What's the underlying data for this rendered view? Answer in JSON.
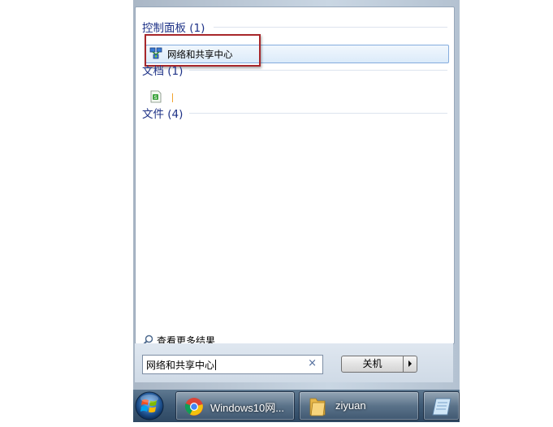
{
  "menu": {
    "sections": [
      {
        "header": "控制面板 (1)"
      },
      {
        "header": "文档 (1)"
      },
      {
        "header": "文件 (4)"
      }
    ],
    "result": {
      "label": "网络和共享中心"
    },
    "more_results": "查看更多结果",
    "search": {
      "value": "网络和共享中心",
      "clear": "×"
    },
    "shutdown_label": "关机"
  },
  "taskbar": {
    "items": [
      {
        "label": "Windows10网..."
      },
      {
        "label": "ziyuan"
      }
    ]
  },
  "colors": {
    "section_header": "#1e3287",
    "highlight_border": "#a8272b",
    "taskbar": "#3e5a75"
  },
  "icons": [
    "network-icon",
    "document-icon",
    "search-icon",
    "chrome-icon",
    "folder-icon",
    "notepad-icon",
    "windows-orb-icon"
  ]
}
